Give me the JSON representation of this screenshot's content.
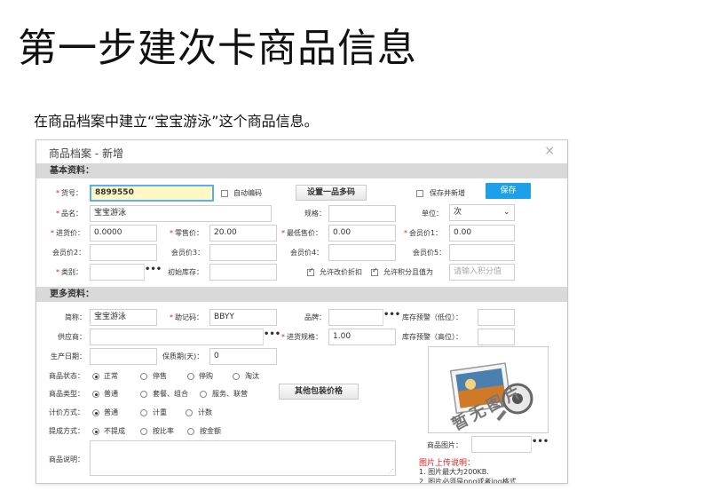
{
  "slide": {
    "title": "第一步建次卡商品信息",
    "description": "在商品档案中建立“宝宝游泳”这个商品信息。"
  },
  "dialog": {
    "title": "商品档案 - 新增",
    "close": "×"
  },
  "basic": {
    "section": "基本资料：",
    "sku_label": "货号：",
    "sku_value": "8899550",
    "auto_code": "自动编码",
    "multi_code_button": "设置一品多码",
    "save_and_new": "保存并新增",
    "save_button": "保存",
    "name_label": "品名：",
    "name_value": "宝宝游泳",
    "spec_label": "规格：",
    "spec_value": "",
    "unit_label": "单位：",
    "unit_value": "次",
    "cost_label": "进货价：",
    "cost_value": "0.0000",
    "retail_label": "零售价：",
    "retail_value": "20.00",
    "min_price_label": "最低售价：",
    "min_price_value": "0.00",
    "member1_label": "会员价1：",
    "member1_value": "0.00",
    "member2_label": "会员价2：",
    "member3_label": "会员价3：",
    "member4_label": "会员价4：",
    "member5_label": "会员价5：",
    "category_label": "类别：",
    "initial_stock_label": "初始库存：",
    "allow_discount": "允许改价折扣",
    "allow_points": "允许积分且值为",
    "points_placeholder": "请输入积分值",
    "dots": "•••"
  },
  "more": {
    "section": "更多资料：",
    "short_label": "简称：",
    "short_value": "宝宝游泳",
    "mnemonic_label": "助记码：",
    "mnemonic_value": "BBYY",
    "brand_label": "品牌：",
    "stock_low_label": "库存预警（低位）：",
    "supplier_label": "供应商：",
    "purchase_spec_label": "进货规格：",
    "purchase_spec_value": "1.00",
    "stock_high_label": "库存预警（高位）：",
    "mfg_date_label": "生产日期：",
    "shelf_life_label": "保质期(天)：",
    "shelf_life_value": "0",
    "status_label": "商品状态：",
    "status_options": [
      "正常",
      "停售",
      "停购",
      "淘汰"
    ],
    "type_label": "商品类型：",
    "type_options": [
      "普通",
      "套餐、组合",
      "服务、联营"
    ],
    "other_pack_button": "其他包装价格",
    "pricing_label": "计价方式：",
    "pricing_options": [
      "普通",
      "计重",
      "计数"
    ],
    "commission_label": "提成方式：",
    "commission_options": [
      "不提成",
      "按比率",
      "按金额"
    ],
    "desc_label": "商品说明：",
    "image_label": "商品图片：",
    "image_placeholder_text": "暂无图片",
    "upload_title": "图片上传说明：",
    "upload_line1": "1. 图片最大为200KB.",
    "upload_line2": "2. 图片必须是png或者jpg格式."
  }
}
